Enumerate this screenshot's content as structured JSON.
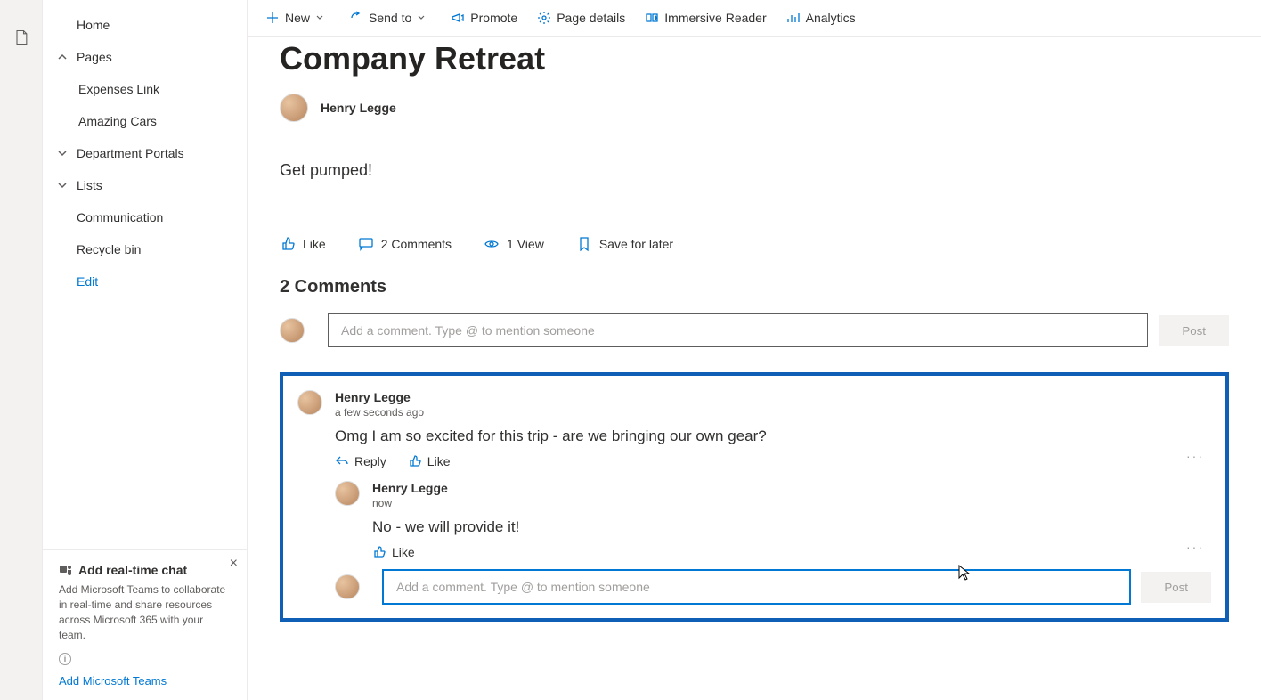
{
  "rail": {
    "icon": "document-icon"
  },
  "sidebar": {
    "home": "Home",
    "pages": "Pages",
    "pages_children": [
      "Expenses Link",
      "Amazing Cars"
    ],
    "dept": "Department Portals",
    "lists": "Lists",
    "communication": "Communication",
    "recycle": "Recycle bin",
    "edit": "Edit"
  },
  "promo": {
    "title": "Add real-time chat",
    "body": "Add Microsoft Teams to collaborate in real-time and share resources across Microsoft 365 with your team.",
    "link": "Add Microsoft Teams"
  },
  "toolbar": {
    "new": "New",
    "send": "Send to",
    "promote": "Promote",
    "details": "Page details",
    "reader": "Immersive Reader",
    "analytics": "Analytics"
  },
  "page": {
    "title": "Company Retreat",
    "author": "Henry Legge",
    "body": "Get pumped!"
  },
  "stats": {
    "like": "Like",
    "comments": "2 Comments",
    "views": "1 View",
    "save": "Save for later"
  },
  "comments": {
    "header": "2 Comments",
    "placeholder": "Add a comment. Type @ to mention someone",
    "post": "Post",
    "reply": "Reply",
    "like": "Like",
    "items": [
      {
        "author": "Henry Legge",
        "time": "a few seconds ago",
        "text": "Omg I am so excited for this trip - are we bringing our own gear?"
      },
      {
        "author": "Henry Legge",
        "time": "now",
        "text": "No - we will provide it!"
      }
    ]
  }
}
